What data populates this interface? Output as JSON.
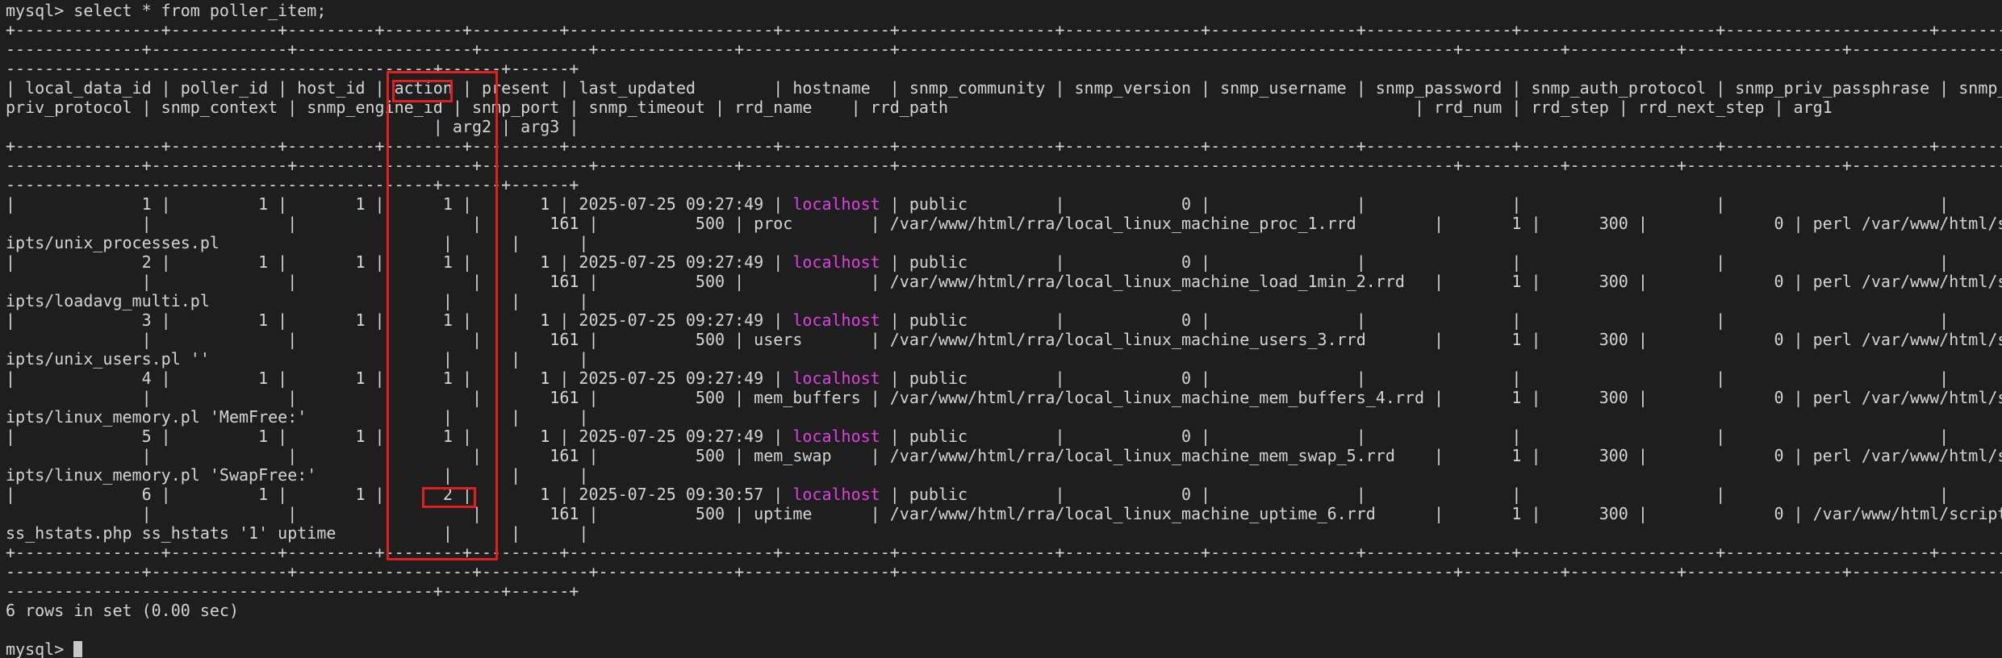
{
  "terminal": {
    "lines": [
      "mysql> select * from poller_item;",
      "+---------------+-----------+---------+--------+---------+---------------------+-----------+----------------+--------------+---------------+---------------+--------------------+---------------------+---------",
      "--------------+--------------+------------------+-----------+--------------+---------------+---------------------------------------------------------+----------+-----------+----------------+-------------------",
      "--------------------------------------------+------+------+",
      "| local_data_id | poller_id | host_id | action | present | last_updated        | hostname  | snmp_community | snmp_version | snmp_username | snmp_password | snmp_auth_protocol | snmp_priv_passphrase | snmp_",
      "priv_protocol | snmp_context | snmp_engine_id | snmp_port | snmp_timeout | rrd_name    | rrd_path                                                | rrd_num | rrd_step | rrd_next_step | arg1",
      "                                            | arg2 | arg3 |",
      "+---------------+-----------+---------+--------+---------+---------------------+-----------+----------------+--------------+---------------+---------------+--------------------+---------------------+---------",
      "--------------+--------------+------------------+-----------+--------------+---------------+---------------------------------------------------------+----------+-----------+----------------+-------------------",
      "--------------------------------------------+------+------+",
      "|             1 |         1 |       1 |      1 |       1 | 2025-07-25 09:27:49 | localhost | public         |            0 |               |               |                    |                      |",
      "              |              |                  |       161 |          500 | proc        | /var/www/html/rra/local_linux_machine_proc_1.rrd        |       1 |      300 |             0 | perl /var/www/html/scr",
      "ipts/unix_processes.pl                       |      |      |",
      "|             2 |         1 |       1 |      1 |       1 | 2025-07-25 09:27:49 | localhost | public         |            0 |               |               |                    |                      |",
      "              |              |                  |       161 |          500 |             | /var/www/html/rra/local_linux_machine_load_1min_2.rrd   |       1 |      300 |             0 | perl /var/www/html/scr",
      "ipts/loadavg_multi.pl                        |      |      |",
      "|             3 |         1 |       1 |      1 |       1 | 2025-07-25 09:27:49 | localhost | public         |            0 |               |               |                    |                      |",
      "              |              |                  |       161 |          500 | users       | /var/www/html/rra/local_linux_machine_users_3.rrd       |       1 |      300 |             0 | perl /var/www/html/scr",
      "ipts/unix_users.pl ''                        |      |      |",
      "|             4 |         1 |       1 |      1 |       1 | 2025-07-25 09:27:49 | localhost | public         |            0 |               |               |                    |                      |",
      "              |              |                  |       161 |          500 | mem_buffers | /var/www/html/rra/local_linux_machine_mem_buffers_4.rrd |       1 |      300 |             0 | perl /var/www/html/scr",
      "ipts/linux_memory.pl 'MemFree:'              |      |      |",
      "|             5 |         1 |       1 |      1 |       1 | 2025-07-25 09:27:49 | localhost | public         |            0 |               |               |                    |                      |",
      "              |              |                  |       161 |          500 | mem_swap    | /var/www/html/rra/local_linux_machine_mem_swap_5.rrd    |       1 |      300 |             0 | perl /var/www/html/scr",
      "ipts/linux_memory.pl 'SwapFree:'             |      |      |",
      "|             6 |         1 |       1 |      2 |       1 | 2025-07-25 09:30:57 | localhost | public         |            0 |               |               |                    |                      |",
      "              |              |                  |       161 |          500 | uptime      | /var/www/html/rra/local_linux_machine_uptime_6.rrd      |       1 |      300 |             0 | /var/www/html/scripts/",
      "ss_hstats.php ss_hstats '1' uptime           |      |      |",
      "+---------------+-----------+---------+--------+---------+---------------------+-----------+----------------+--------------+---------------+---------------+--------------------+---------------------+---------",
      "--------------+--------------+------------------+-----------+--------------+---------------+---------------------------------------------------------+----------+-----------+----------------+-------------------",
      "--------------------------------------------+------+------+",
      "6 rows in set (0.00 sec)",
      "",
      "mysql> "
    ],
    "highlight_word": "localhost",
    "highlight_color": "#e040e0",
    "annotation_color": "#e02020"
  }
}
